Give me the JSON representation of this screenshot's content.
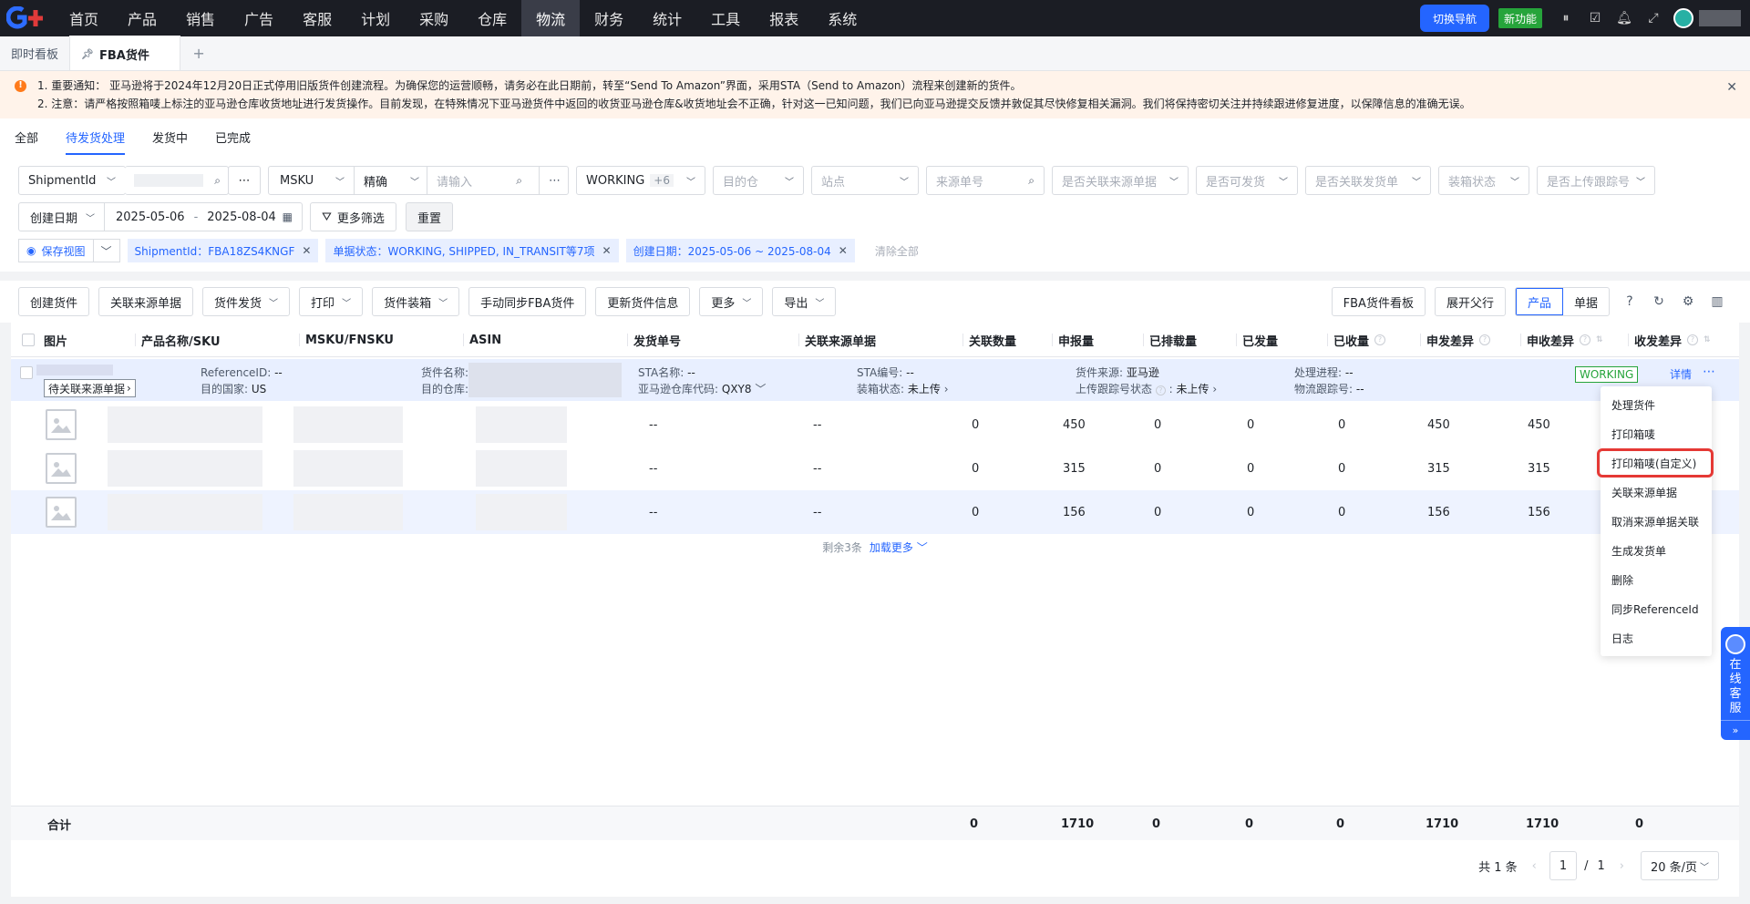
{
  "nav": {
    "items": [
      "首页",
      "产品",
      "销售",
      "广告",
      "客服",
      "计划",
      "采购",
      "仓库",
      "物流",
      "财务",
      "统计",
      "工具",
      "报表",
      "系统"
    ],
    "active": "物流",
    "switch_label": "切换导航",
    "new_feature_label": "新功能"
  },
  "tabs": {
    "home": "即时看板",
    "active": "FBA货件",
    "add": "+"
  },
  "notice": {
    "line1": "1. 重要通知： 亚马逊将于2024年12月20日正式停用旧版货件创建流程。为确保您的运营顺畅，请务必在此日期前，转至“Send To Amazon”界面，采用STA（Send to Amazon）流程来创建新的货件。",
    "line2": "2. 注意：请严格按照箱唛上标注的亚马逊仓库收货地址进行发货操作。目前发现，在特殊情况下亚马逊货件中返回的收货亚马逊仓库&收货地址会不正确，针对这一已知问题，我们已向亚马逊提交反馈并敦促其尽快修复相关漏洞。我们将保持密切关注并持续跟进修复进度，以保障信息的准确无误。"
  },
  "subtabs": [
    "全部",
    "待发货处理",
    "发货中",
    "已完成"
  ],
  "subtab_active": "待发货处理",
  "filters": {
    "shipment_field": "ShipmentId",
    "msku_field": "MSKU",
    "match_mode": "精确",
    "input_placeholder": "请输入",
    "status_value": "WORKING",
    "status_more": "+6",
    "dest_placeholder": "目的仓",
    "site_placeholder": "站点",
    "source_no_placeholder": "来源单号",
    "linked_source_placeholder": "是否关联来源单据",
    "can_ship_placeholder": "是否可发货",
    "linked_ship_placeholder": "是否关联发货单",
    "packing_placeholder": "装箱状态",
    "tracking_placeholder": "是否上传跟踪号",
    "date_field": "创建日期",
    "date_from": "2025-05-06",
    "date_sep": "-",
    "date_to": "2025-08-04",
    "more_filters": "更多筛选",
    "reset": "重置",
    "save_view": "保存视图",
    "chips": [
      "ShipmentId：FBA18ZS4KNGF",
      "单据状态：WORKING, SHIPPED, IN_TRANSIT等7项",
      "创建日期：2025-05-06 ~ 2025-08-04"
    ],
    "clear_all": "清除全部"
  },
  "toolbar": {
    "buttons": [
      "创建货件",
      "关联来源单据",
      "货件发货",
      "打印",
      "货件装箱",
      "手动同步FBA货件",
      "更新货件信息",
      "更多",
      "导出"
    ],
    "dropdown_flags": [
      false,
      false,
      true,
      true,
      true,
      false,
      false,
      true,
      true
    ],
    "board": "FBA货件看板",
    "expand": "展开父行",
    "view_product": "产品",
    "view_doc": "单据"
  },
  "table": {
    "headers": [
      "图片",
      "产品名称/SKU",
      "MSKU/FNSKU",
      "ASIN",
      "发货单号",
      "关联来源单据",
      "关联数量",
      "申报量",
      "已排载量",
      "已发量",
      "已收量",
      "申发差异",
      "申收差异",
      "收发差异"
    ],
    "group": {
      "link_btn": "待关联来源单据",
      "reference_label": "ReferenceID:",
      "reference_value": "--",
      "country_label": "目的国家:",
      "country_value": "US",
      "name_label": "货件名称:",
      "warehouse_label": "目的仓库:",
      "sta_name_label": "STA名称:",
      "sta_name_value": "--",
      "wh_code_label": "亚马逊仓库代码:",
      "wh_code_value": "QXY8",
      "sta_no_label": "STA编号:",
      "sta_no_value": "--",
      "packing_label": "装箱状态:",
      "packing_value": "未上传",
      "source_label": "货件来源:",
      "source_value": "亚马逊",
      "tracking_label": "上传跟踪号状态",
      "tracking_value": "未上传",
      "progress_label": "处理进程:",
      "progress_value": "--",
      "logistics_label": "物流跟踪号:",
      "logistics_value": "--",
      "status": "WORKING",
      "detail": "详情"
    },
    "rows": [
      {
        "ship_no": "--",
        "linked": "--",
        "qty": "0",
        "declared": "450",
        "scheduled": "0",
        "shipped": "0",
        "received": "0",
        "diff_ship": "450",
        "diff_recv": "450"
      },
      {
        "ship_no": "--",
        "linked": "--",
        "qty": "0",
        "declared": "315",
        "scheduled": "0",
        "shipped": "0",
        "received": "0",
        "diff_ship": "315",
        "diff_recv": "315"
      },
      {
        "ship_no": "--",
        "linked": "--",
        "qty": "0",
        "declared": "156",
        "scheduled": "0",
        "shipped": "0",
        "received": "0",
        "diff_ship": "156",
        "diff_recv": "156"
      }
    ],
    "remaining": "剩余3条",
    "load_more": "加载更多",
    "summary": {
      "label": "合计",
      "qty": "0",
      "declared": "1710",
      "scheduled": "0",
      "shipped": "0",
      "received": "0",
      "diff_ship": "1710",
      "diff_recv": "1710",
      "diff_rs": "0"
    }
  },
  "pager": {
    "total": "共 1 条",
    "page": "1",
    "sep": "/",
    "pages": "1",
    "size": "20 条/页"
  },
  "menu": {
    "items": [
      "处理货件",
      "打印箱唛",
      "打印箱唛(自定义)",
      "关联来源单据",
      "取消来源单据关联",
      "生成发货单",
      "删除",
      "同步ReferenceId",
      "日志"
    ],
    "selected": "打印箱唛(自定义)"
  },
  "float": {
    "label_chars": [
      "在",
      "线",
      "客",
      "服"
    ]
  },
  "colors": {
    "accent": "#2465ff",
    "success": "#26a43b",
    "alert": "#e53935",
    "nav_bg": "#1b1d24"
  }
}
